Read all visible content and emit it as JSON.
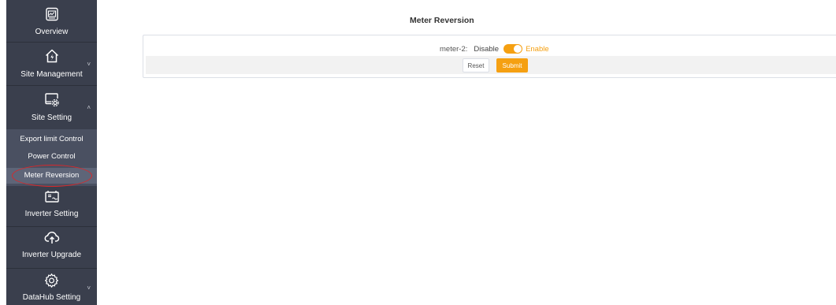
{
  "sidebar": {
    "items": [
      {
        "label": "Overview",
        "icon": "monitor-icon"
      },
      {
        "label": "Site Management",
        "icon": "home-power-icon",
        "chevron": "˅"
      },
      {
        "label": "Site Setting",
        "icon": "screen-gear-icon",
        "chevron": "˄",
        "children": [
          {
            "label": "Export limit Control"
          },
          {
            "label": "Power Control"
          },
          {
            "label": "Meter Reversion",
            "active": true
          }
        ]
      },
      {
        "label": "Inverter Setting",
        "icon": "inverter-icon"
      },
      {
        "label": "Inverter Upgrade",
        "icon": "cloud-upload-icon"
      },
      {
        "label": "DataHub Setting",
        "icon": "gear-icon",
        "chevron": "˅"
      }
    ]
  },
  "main": {
    "title": "Meter Reversion",
    "meter": {
      "label": "meter-2:",
      "option_off": "Disable",
      "option_on": "Enable",
      "enabled": true
    },
    "buttons": {
      "reset": "Reset",
      "submit": "Submit"
    }
  },
  "colors": {
    "sidebar_bg": "#3a3f4d",
    "submenu_bg": "#4a5061",
    "accent": "#f5a012",
    "highlight_ring": "#d8282b"
  }
}
